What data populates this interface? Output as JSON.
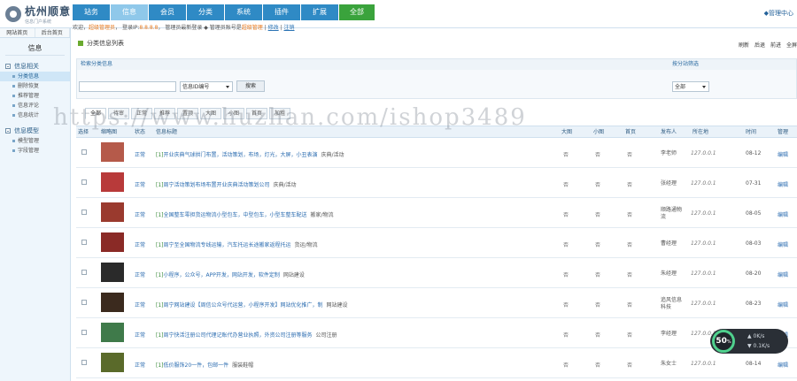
{
  "logo": {
    "title": "杭州顺意",
    "subtitle": "信息门户系统"
  },
  "nav": [
    "站务",
    "信息",
    "会员",
    "分类",
    "系统",
    "插件",
    "扩展",
    "全部"
  ],
  "admin_link": "◆管理中心",
  "infobar": {
    "greet": "欢迎",
    "user": "超级管理员",
    "ip_label": "登录IP:",
    "ip": "8.8.8.8",
    "time_label": "管理员最新登录",
    "role_label": "管理员账号是",
    "role": "超级管理",
    "link1": "修改",
    "link2": "注销"
  },
  "sidebar": {
    "tabs": [
      "网站首页",
      "后台首页"
    ],
    "title": "信息",
    "groups": [
      {
        "name": "信息相关",
        "items": [
          "分类信息",
          "删除恢复",
          "推荐管理",
          "信息评论",
          "信息统计"
        ]
      },
      {
        "name": "信息模型",
        "items": [
          "模型管理",
          "字段管理"
        ]
      }
    ]
  },
  "page_title": "分类信息列表",
  "top_actions": [
    "刷新",
    "后退",
    "前进",
    "全屏"
  ],
  "search": {
    "heading": "检索分类信息",
    "select_value": "信息ID编号",
    "button": "搜索",
    "site_heading": "按分站筛选",
    "site_value": "全部"
  },
  "filter_tabs": [
    "全部",
    "待审",
    "正常",
    "推荐",
    "置顶",
    "大图",
    "小图",
    "首页",
    "加粗"
  ],
  "columns": [
    "选择",
    "缩略图",
    "状态",
    "信息标题",
    "大图",
    "小图",
    "首页",
    "发布人",
    "所在地",
    "时间",
    "管理"
  ],
  "rows": [
    {
      "status": "正常",
      "mark": "[1]",
      "title": "开业庆典气球拱门布置，活动策划，布场，灯光，大屏，小丑表演",
      "cat": "庆典/活动",
      "big": "否",
      "small": "否",
      "home": "否",
      "poster": "李老师",
      "ip": "127.0.0.1",
      "date": "08-12",
      "edit": "编辑",
      "thumb": "#b55a4a"
    },
    {
      "status": "正常",
      "mark": "[1]",
      "title": "周宁活动策划布场布置开业庆典活动策划公司",
      "cat": "庆典/活动",
      "big": "否",
      "small": "否",
      "home": "否",
      "poster": "张经理",
      "ip": "127.0.0.1",
      "date": "07-31",
      "edit": "编辑",
      "thumb": "#b83a3a"
    },
    {
      "status": "正常",
      "mark": "[1]",
      "title": "全国整车零担货运物流小型包车，中型包车，小型车整车配送",
      "cat": "搬家/物流",
      "big": "否",
      "small": "否",
      "home": "否",
      "poster": "顺路通物流",
      "ip": "127.0.0.1",
      "date": "08-05",
      "edit": "编辑",
      "thumb": "#9a3a2e"
    },
    {
      "status": "正常",
      "mark": "[1]",
      "title": "周宁至全国物流专线运输，汽车托运长途搬家返程托运",
      "cat": "货运/物流",
      "big": "否",
      "small": "否",
      "home": "否",
      "poster": "曹经理",
      "ip": "127.0.0.1",
      "date": "08-03",
      "edit": "编辑",
      "thumb": "#8a2a26"
    },
    {
      "status": "正常",
      "mark": "[1]",
      "title": "小程序，公众号，APP开发，网站开发，软件定制",
      "cat": "网站建设",
      "big": "否",
      "small": "否",
      "home": "否",
      "poster": "朱经理",
      "ip": "127.0.0.1",
      "date": "08-20",
      "edit": "编辑",
      "thumb": "#2a2a2a"
    },
    {
      "status": "正常",
      "mark": "[1]",
      "title": "周宁网站建设【周信公众号代运营，小程序开发】网站优化推广，制",
      "cat": "网站建设",
      "big": "否",
      "small": "否",
      "home": "否",
      "poster": "追风信息科技",
      "ip": "127.0.0.1",
      "date": "08-23",
      "edit": "编辑",
      "thumb": "#3b2a1e"
    },
    {
      "status": "正常",
      "mark": "[1]",
      "title": "周宁快活注册公司代理记账代办营业执照，外资公司注册等服务",
      "cat": "公司注册",
      "big": "否",
      "small": "否",
      "home": "否",
      "poster": "李经理",
      "ip": "127.0.0.1",
      "date": "08-26",
      "edit": "编辑",
      "thumb": "#3f7a4a"
    },
    {
      "status": "正常",
      "mark": "[1]",
      "title": "低价服饰20一件，包邮一件",
      "cat": "服装鞋帽",
      "big": "否",
      "small": "否",
      "home": "否",
      "poster": "朱女士",
      "ip": "127.0.0.1",
      "date": "08-14",
      "edit": "编辑",
      "thumb": "#5a6a2a"
    }
  ],
  "speed_widget": {
    "percent": "50",
    "unit": "%",
    "up": "0K/s",
    "down": "0.1K/s"
  },
  "watermark": "https://www.huzhan.com/ishop3489"
}
